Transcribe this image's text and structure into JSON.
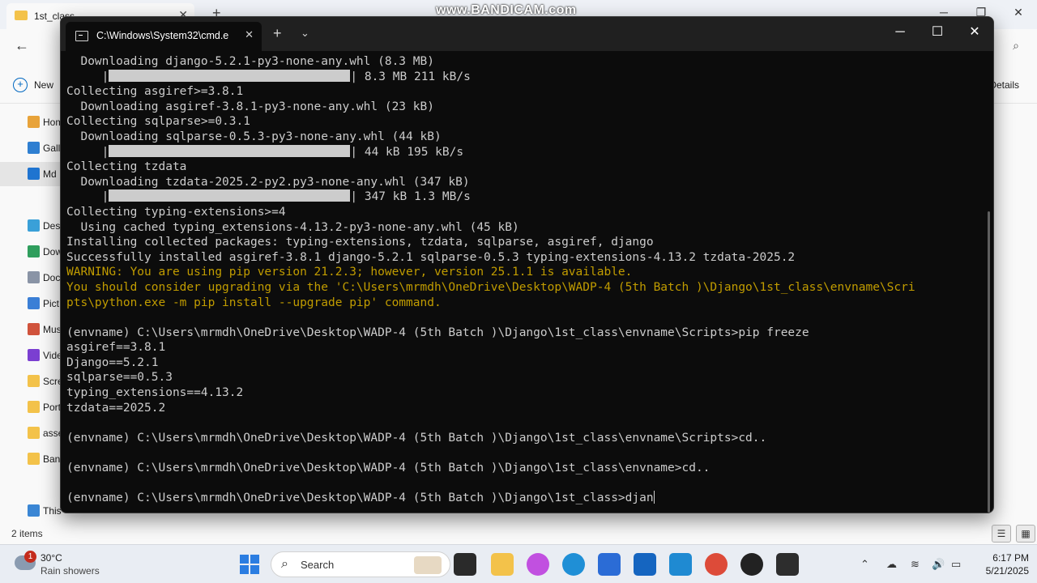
{
  "watermark": "www.BANDICAM.com",
  "explorer": {
    "tab_title": "1st_class",
    "new_label": "New",
    "details_label": "Details",
    "sidebar": [
      {
        "label": "Hom",
        "color": "#e8a33a"
      },
      {
        "label": "Gall",
        "color": "#2f7fd1"
      },
      {
        "label": "Md",
        "color": "#1f74d0"
      },
      {
        "label": "Desk",
        "color": "#3aa0d8"
      },
      {
        "label": "Dow",
        "color": "#2f9e5d"
      },
      {
        "label": "Doc",
        "color": "#8a94a6"
      },
      {
        "label": "Pict",
        "color": "#3b7fd6"
      },
      {
        "label": "Mus",
        "color": "#d0533c"
      },
      {
        "label": "Vide",
        "color": "#7b3fd1"
      },
      {
        "label": "Scre",
        "color": "#f3c24a"
      },
      {
        "label": "Port",
        "color": "#f3c24a"
      },
      {
        "label": "asse",
        "color": "#f3c24a"
      },
      {
        "label": "Ban",
        "color": "#f3c24a"
      },
      {
        "label": "This",
        "color": "#3a86d4"
      }
    ],
    "status": "2 items"
  },
  "terminal": {
    "tab_title": "C:\\Windows\\System32\\cmd.e",
    "lines": [
      {
        "text": "  Downloading django-5.2.1-py3-none-any.whl (8.3 MB)",
        "type": "normal"
      },
      {
        "pre": "     |",
        "post": "| 8.3 MB 211 kB/s",
        "type": "bar"
      },
      {
        "text": "Collecting asgiref>=3.8.1",
        "type": "normal"
      },
      {
        "text": "  Downloading asgiref-3.8.1-py3-none-any.whl (23 kB)",
        "type": "normal"
      },
      {
        "text": "Collecting sqlparse>=0.3.1",
        "type": "normal"
      },
      {
        "text": "  Downloading sqlparse-0.5.3-py3-none-any.whl (44 kB)",
        "type": "normal"
      },
      {
        "pre": "     |",
        "post": "| 44 kB 195 kB/s",
        "type": "bar"
      },
      {
        "text": "Collecting tzdata",
        "type": "normal"
      },
      {
        "text": "  Downloading tzdata-2025.2-py2.py3-none-any.whl (347 kB)",
        "type": "normal"
      },
      {
        "pre": "     |",
        "post": "| 347 kB 1.3 MB/s",
        "type": "bar"
      },
      {
        "text": "Collecting typing-extensions>=4",
        "type": "normal"
      },
      {
        "text": "  Using cached typing_extensions-4.13.2-py3-none-any.whl (45 kB)",
        "type": "normal"
      },
      {
        "text": "Installing collected packages: typing-extensions, tzdata, sqlparse, asgiref, django",
        "type": "normal"
      },
      {
        "text": "Successfully installed asgiref-3.8.1 django-5.2.1 sqlparse-0.5.3 typing-extensions-4.13.2 tzdata-2025.2",
        "type": "normal"
      },
      {
        "text": "WARNING: You are using pip version 21.2.3; however, version 25.1.1 is available.",
        "type": "warn"
      },
      {
        "text": "You should consider upgrading via the 'C:\\Users\\mrmdh\\OneDrive\\Desktop\\WADP-4 (5th Batch )\\Django\\1st_class\\envname\\Scri",
        "type": "warn"
      },
      {
        "text": "pts\\python.exe -m pip install --upgrade pip' command.",
        "type": "warn"
      },
      {
        "text": "",
        "type": "normal"
      },
      {
        "text": "(envname) C:\\Users\\mrmdh\\OneDrive\\Desktop\\WADP-4 (5th Batch )\\Django\\1st_class\\envname\\Scripts>pip freeze",
        "type": "normal"
      },
      {
        "text": "asgiref==3.8.1",
        "type": "normal"
      },
      {
        "text": "Django==5.2.1",
        "type": "normal"
      },
      {
        "text": "sqlparse==0.5.3",
        "type": "normal"
      },
      {
        "text": "typing_extensions==4.13.2",
        "type": "normal"
      },
      {
        "text": "tzdata==2025.2",
        "type": "normal"
      },
      {
        "text": "",
        "type": "normal"
      },
      {
        "text": "(envname) C:\\Users\\mrmdh\\OneDrive\\Desktop\\WADP-4 (5th Batch )\\Django\\1st_class\\envname\\Scripts>cd..",
        "type": "normal"
      },
      {
        "text": "",
        "type": "normal"
      },
      {
        "text": "(envname) C:\\Users\\mrmdh\\OneDrive\\Desktop\\WADP-4 (5th Batch )\\Django\\1st_class\\envname>cd..",
        "type": "normal"
      },
      {
        "text": "",
        "type": "normal"
      },
      {
        "text": "(envname) C:\\Users\\mrmdh\\OneDrive\\Desktop\\WADP-4 (5th Batch )\\Django\\1st_class>djan",
        "type": "prompt"
      }
    ]
  },
  "taskbar": {
    "weather_badge": "1",
    "temperature": "30°C",
    "condition": "Rain showers",
    "search_placeholder": "Search",
    "apps": [
      {
        "name": "task-view",
        "color": "#2a2a2a"
      },
      {
        "name": "file-explorer",
        "color": "#f3c24a"
      },
      {
        "name": "copilot",
        "color": "#c150e0"
      },
      {
        "name": "edge",
        "color": "#1f8fd6"
      },
      {
        "name": "store",
        "color": "#2b6cd6"
      },
      {
        "name": "outlook",
        "color": "#1565c0"
      },
      {
        "name": "vscode",
        "color": "#1f8ad2"
      },
      {
        "name": "chrome",
        "color": "#dd4b39"
      },
      {
        "name": "bandicam",
        "color": "#222222"
      },
      {
        "name": "terminal",
        "color": "#2d2d2d"
      }
    ],
    "time": "6:17 PM",
    "date": "5/21/2025"
  }
}
